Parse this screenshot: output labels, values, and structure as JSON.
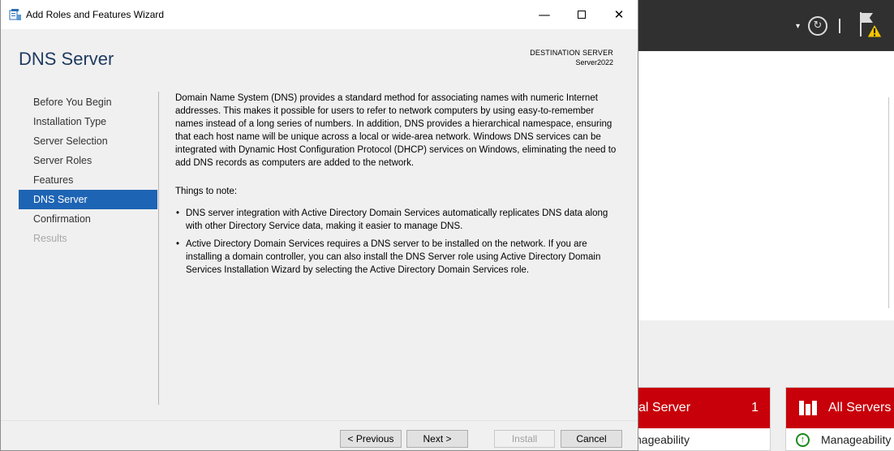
{
  "window": {
    "title": "Add Roles and Features Wizard"
  },
  "header": {
    "page_title": "DNS Server",
    "destination_label": "DESTINATION SERVER",
    "destination_name": "Server2022"
  },
  "nav": {
    "items": [
      {
        "label": "Before You Begin",
        "state": "normal"
      },
      {
        "label": "Installation Type",
        "state": "normal"
      },
      {
        "label": "Server Selection",
        "state": "normal"
      },
      {
        "label": "Server Roles",
        "state": "normal"
      },
      {
        "label": "Features",
        "state": "normal"
      },
      {
        "label": "DNS Server",
        "state": "active"
      },
      {
        "label": "Confirmation",
        "state": "normal"
      },
      {
        "label": "Results",
        "state": "disabled"
      }
    ]
  },
  "content": {
    "intro": "Domain Name System (DNS) provides a standard method for associating names with numeric Internet addresses. This makes it possible for users to refer to network computers by using easy-to-remember names instead of a long series of numbers. In addition, DNS provides a hierarchical namespace, ensuring that each host name will be unique across a local or wide-area network. Windows DNS services can be integrated with Dynamic Host Configuration Protocol (DHCP) services on Windows, eliminating the need to add DNS records as computers are added to the network.",
    "notes_heading": "Things to note:",
    "notes": [
      "DNS server integration with Active Directory Domain Services automatically replicates DNS data along with other Directory Service data, making it easier to manage DNS.",
      "Active Directory Domain Services requires a DNS server to be installed on the network. If you are installing a domain controller, you can also install the DNS Server role using Active Directory Domain Services Installation Wizard by selecting the Active Directory Domain Services role."
    ],
    "bullet": "•"
  },
  "buttons": {
    "previous": "< Previous",
    "next": "Next >",
    "install": "Install",
    "cancel": "Cancel"
  },
  "background": {
    "local_tile_title": "al Server",
    "local_tile_count": "1",
    "local_tile_sub": "nageability",
    "all_tile_title": "All Servers",
    "all_tile_sub": "Manageability"
  },
  "colors": {
    "accent_blue": "#1e64b4",
    "tile_red": "#c8000a",
    "header_dark": "#303030"
  }
}
